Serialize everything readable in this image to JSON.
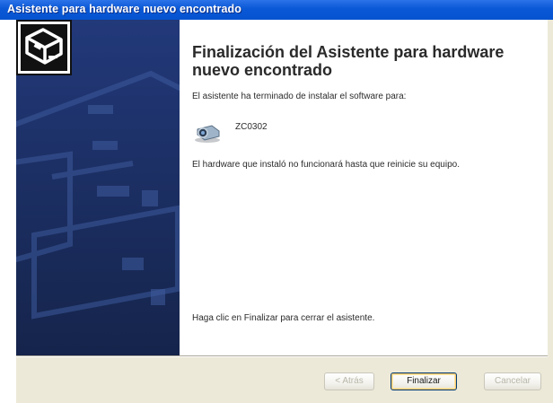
{
  "window": {
    "title": "Asistente para hardware nuevo encontrado"
  },
  "content": {
    "heading": "Finalización del Asistente para hardware nuevo encontrado",
    "install_done": "El asistente ha terminado de instalar el software para:",
    "device_name": "ZC0302",
    "restart_notice": "El hardware que instaló no funcionará hasta que reinicie su equipo.",
    "finish_hint": "Haga clic en Finalizar para cerrar el asistente."
  },
  "buttons": {
    "back": "< Atrás",
    "finish": "Finalizar",
    "cancel": "Cancelar"
  },
  "colors": {
    "titlebar": "#0553cf",
    "side_panel": "#1b3062",
    "button_bar": "#ece9d8"
  }
}
